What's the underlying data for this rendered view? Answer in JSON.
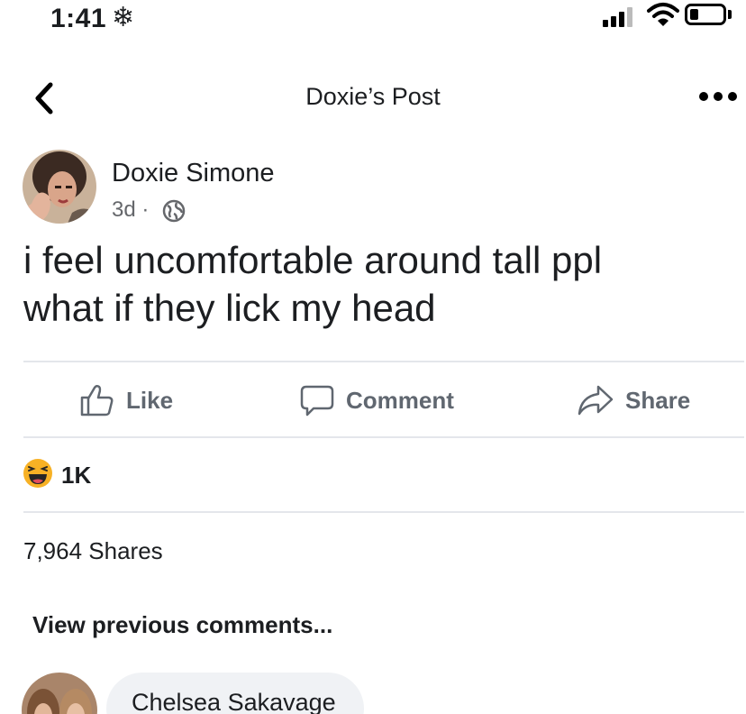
{
  "status_bar": {
    "time": "1:41",
    "snow_symbol": "❄"
  },
  "header": {
    "title": "Doxie’s Post"
  },
  "post": {
    "author": "Doxie Simone",
    "time_ago": "3d",
    "separator": "·",
    "text_line1": "i feel uncomfortable around tall ppl",
    "text_line2": "what if they lick my head"
  },
  "actions": {
    "like_label": "Like",
    "comment_label": "Comment",
    "share_label": "Share"
  },
  "reactions": {
    "count": "1K",
    "emoji": "laughing-emoji"
  },
  "shares": {
    "text": "7,964 Shares"
  },
  "comments": {
    "view_previous": "View previous comments...",
    "first_author": "Chelsea Sakavage"
  },
  "colors": {
    "text": "#1c1e21",
    "muted": "#65676b",
    "divider": "#e4e6eb",
    "bubble": "#f0f2f5",
    "haha": "#f7b125"
  }
}
